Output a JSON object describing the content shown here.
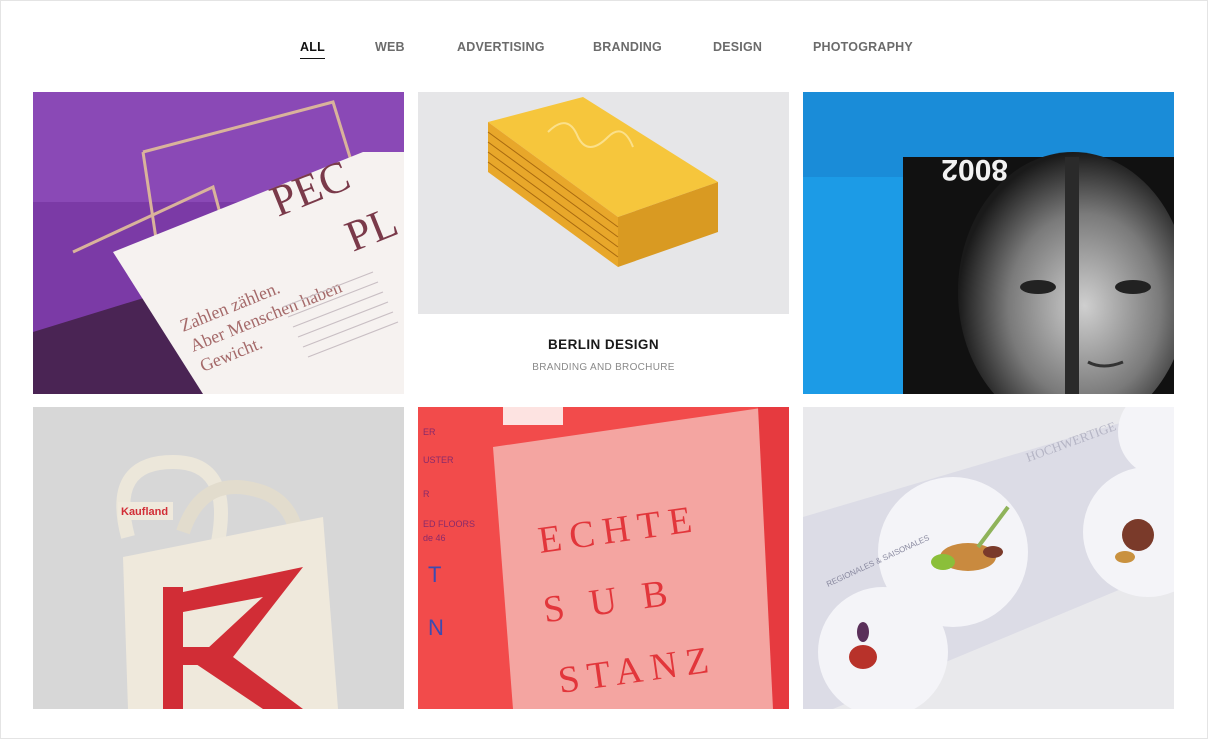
{
  "filters": {
    "items": [
      {
        "label": "ALL"
      },
      {
        "label": "WEB"
      },
      {
        "label": "ADVERTISING"
      },
      {
        "label": "BRANDING"
      },
      {
        "label": "DESIGN"
      },
      {
        "label": "PHOTOGRAPHY"
      }
    ],
    "active": "ALL"
  },
  "portfolio": {
    "tiles": [
      {
        "image_text": {
          "line1": "Zahlen zählen.",
          "line2": "Aber Menschen haben",
          "line3": "Gewicht.",
          "head1": "PEC",
          "head2": "PL"
        },
        "icon": "brochure-image"
      },
      {
        "title": "BERLIN DESIGN",
        "subtitle": "BRANDING AND BROCHURE",
        "icon": "book-stack-image"
      },
      {
        "image_text": {
          "year": "8002"
        },
        "icon": "magazine-portrait-image"
      },
      {
        "image_text": {
          "brand": "Kaufland"
        },
        "icon": "tote-bag-image"
      },
      {
        "image_text": {
          "row1": "ECHTE",
          "row2": "S U B",
          "row3": "STANZ"
        },
        "icon": "open-book-image"
      },
      {
        "image_text": {
          "side": "REGIONALES & SAISONALES",
          "headline": "HOCHWERTIGE"
        },
        "icon": "food-leaflet-image"
      }
    ]
  },
  "colors": {
    "accent": "#111111",
    "purple": "#7b3aa6",
    "yellow": "#f4b935",
    "blue": "#1c9be6",
    "red": "#d8323a",
    "coral": "#f28b86"
  }
}
